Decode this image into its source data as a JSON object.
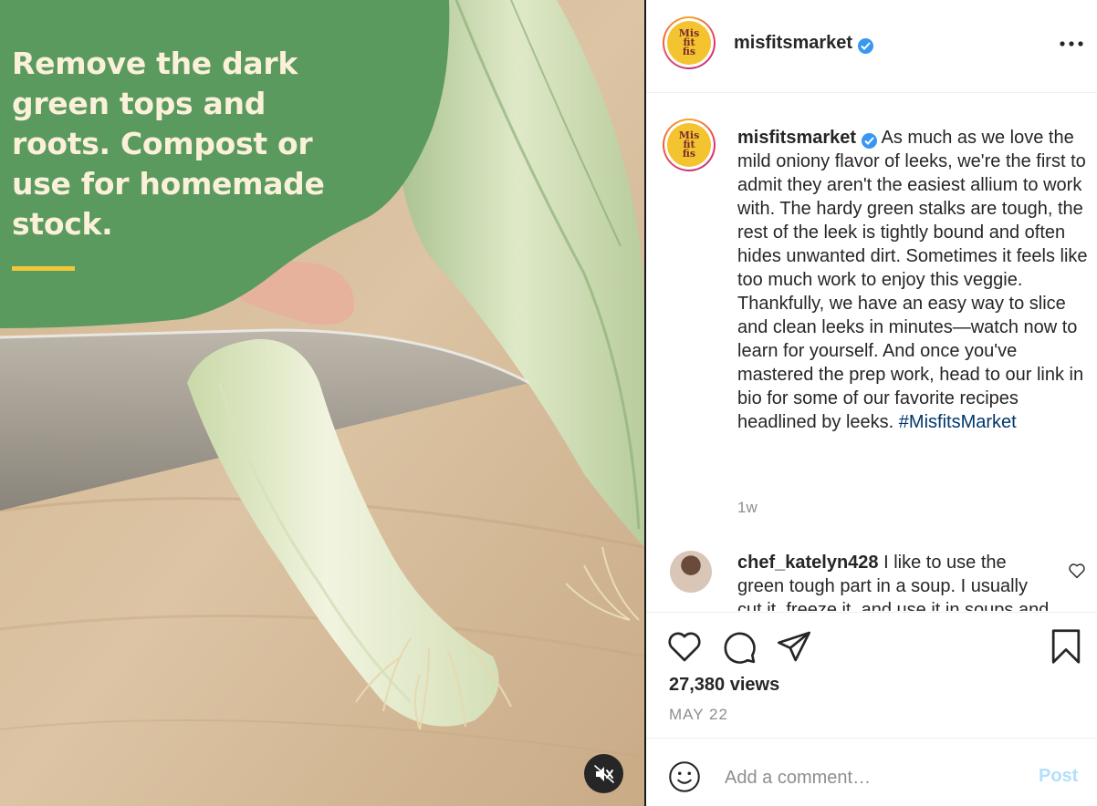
{
  "media": {
    "overlay_text": "Remove the dark green tops and roots. Compost or use for homemade stock.",
    "mute_icon": "speaker-muted-icon",
    "colors": {
      "green_blob": "#5a9a5e",
      "overlay_text": "#fbf0d9",
      "accent_bar": "#f0c63c"
    }
  },
  "header": {
    "username": "misfitsmarket",
    "verified": true,
    "logo_text": [
      "Mis",
      "fit",
      "fis"
    ],
    "more_icon": "more-options-icon"
  },
  "caption": {
    "username": "misfitsmarket",
    "text": "As much as we love the mild oniony flavor of leeks, we're the first to admit they aren't the easiest allium to work with. The hardy green stalks are tough, the rest of the leek is tightly bound and often hides unwanted dirt. Sometimes it feels like too much work to enjoy this veggie. Thankfully, we have an easy way to slice and clean leeks in minutes—watch now to learn for yourself. And once you've mastered the prep work, head to our link in bio for some of our favorite recipes headlined by leeks.",
    "hashtag": "#MisfitsMarket",
    "age": "1w"
  },
  "comments": [
    {
      "username": "chef_katelyn428",
      "text": "I like to use the green tough part in a soup. I usually cut it, freeze it, and use it in soups and stocks.",
      "like_icon": "heart-outline-icon"
    }
  ],
  "actions": {
    "icons": [
      "heart-outline-icon",
      "comment-icon",
      "share-icon",
      "bookmark-icon"
    ],
    "views": "27,380 views",
    "date": "MAY 22"
  },
  "comment_box": {
    "placeholder": "Add a comment…",
    "post_label": "Post",
    "emoji_icon": "emoji-icon"
  },
  "colors": {
    "link": "#00376b",
    "verified": "#3897f0",
    "post_disabled": "#b2dffc",
    "secondary_text": "#8e8e8e"
  }
}
